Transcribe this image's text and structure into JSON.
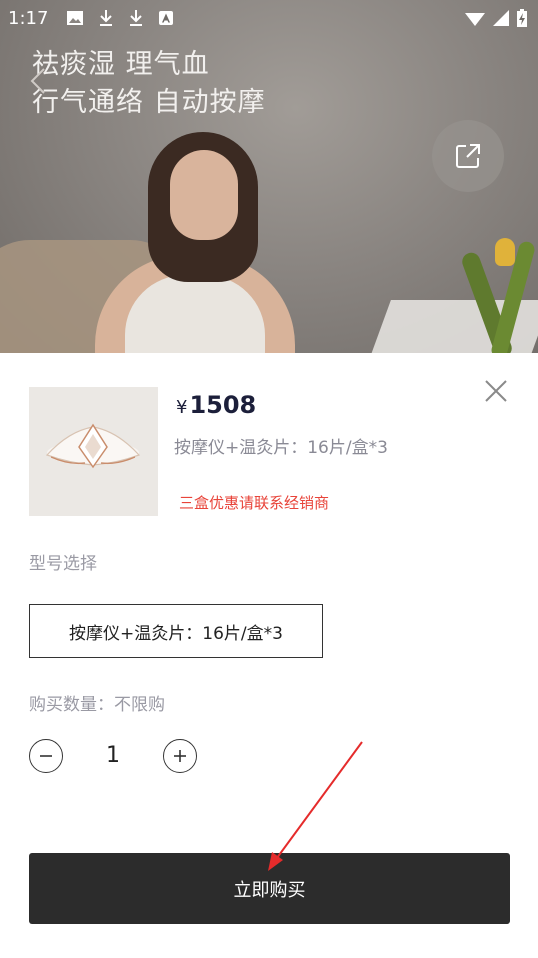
{
  "status_bar": {
    "time": "1:17",
    "left_icons": [
      "image-icon",
      "download-icon",
      "download-icon",
      "app-a-icon"
    ],
    "right_icons": [
      "wifi-icon",
      "signal-icon",
      "battery-charging-icon"
    ]
  },
  "hero": {
    "line1": "祛痰湿 理气血",
    "line2": "行气通络 自动按摩"
  },
  "product": {
    "price_symbol": "¥",
    "price": "1508",
    "spec": "按摩仪+温灸片：16片/盒*3",
    "promo": "三盒优惠请联系经销商"
  },
  "model_section": {
    "label": "型号选择",
    "selected_option": "按摩仪+温灸片：16片/盒*3"
  },
  "quantity": {
    "label": "购买数量：不限购",
    "value": "1"
  },
  "buy_button": {
    "label": "立即购买"
  },
  "colors": {
    "price_text": "#1c1f3a",
    "promo_text": "#e8443a",
    "buy_button_bg": "#2c2c2c",
    "annotation_arrow": "#e52b2b"
  }
}
